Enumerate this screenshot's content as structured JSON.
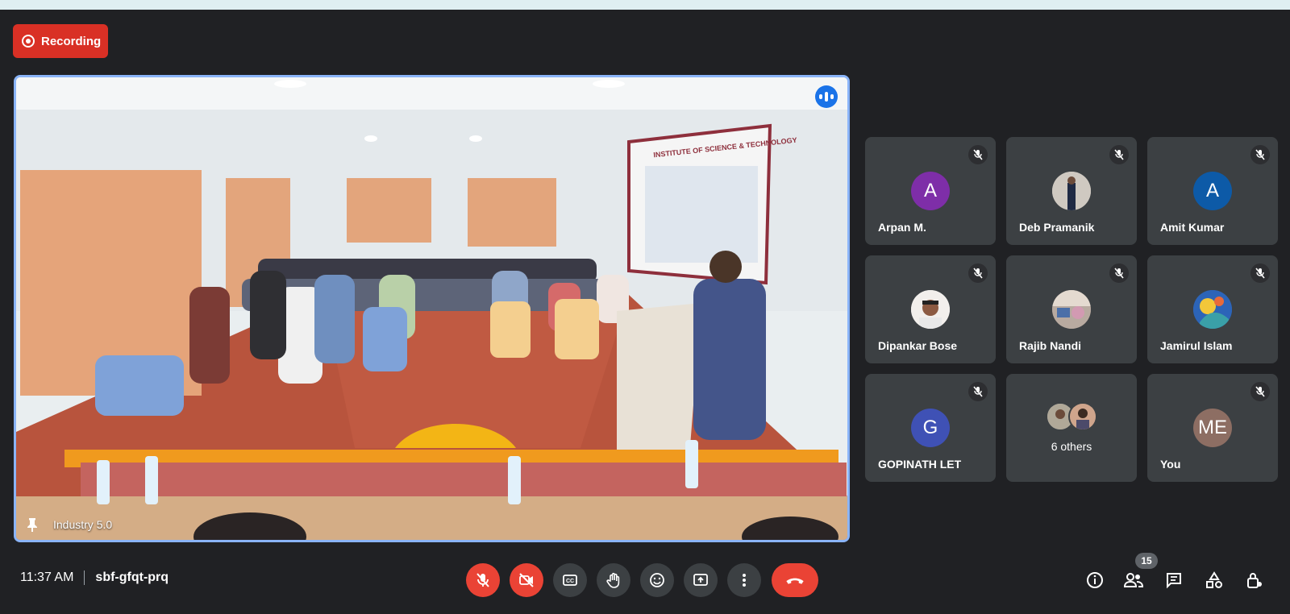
{
  "recording": {
    "label": "Recording"
  },
  "main_video": {
    "label": "Industry 5.0",
    "banner": "INSTITUTE OF SCIENCE & TECHNOLOGY"
  },
  "participants": [
    {
      "name": "Arpan M.",
      "initial": "A",
      "color": "#7e2ea8",
      "muted": true
    },
    {
      "name": "Deb Pramanik",
      "initial": "",
      "color": "#8a8d91",
      "muted": true
    },
    {
      "name": "Amit Kumar",
      "initial": "A",
      "color": "#0d5aa7",
      "muted": true
    },
    {
      "name": "Dipankar Bose",
      "initial": "",
      "color": "#d9d4cf",
      "muted": true
    },
    {
      "name": "Rajib Nandi",
      "initial": "",
      "color": "#9c8f86",
      "muted": true
    },
    {
      "name": "Jamirul Islam",
      "initial": "",
      "color": "#2e6cc4",
      "muted": true
    },
    {
      "name": "GOPINATH LET",
      "initial": "G",
      "color": "#3f51b5",
      "muted": true
    },
    {
      "name": "",
      "others_label": "6 others",
      "muted": false
    },
    {
      "name": "You",
      "initial": "ME",
      "color": "#8d6e63",
      "muted": true
    }
  ],
  "meeting": {
    "time": "11:37 AM",
    "code": "sbf-gfqt-prq"
  },
  "people_count": "15",
  "controls": [
    "mic-off",
    "camera-off",
    "captions",
    "raise-hand",
    "emoji",
    "present",
    "more",
    "leave-call"
  ],
  "right_controls": [
    "info",
    "people",
    "chat",
    "activities",
    "host-controls"
  ]
}
